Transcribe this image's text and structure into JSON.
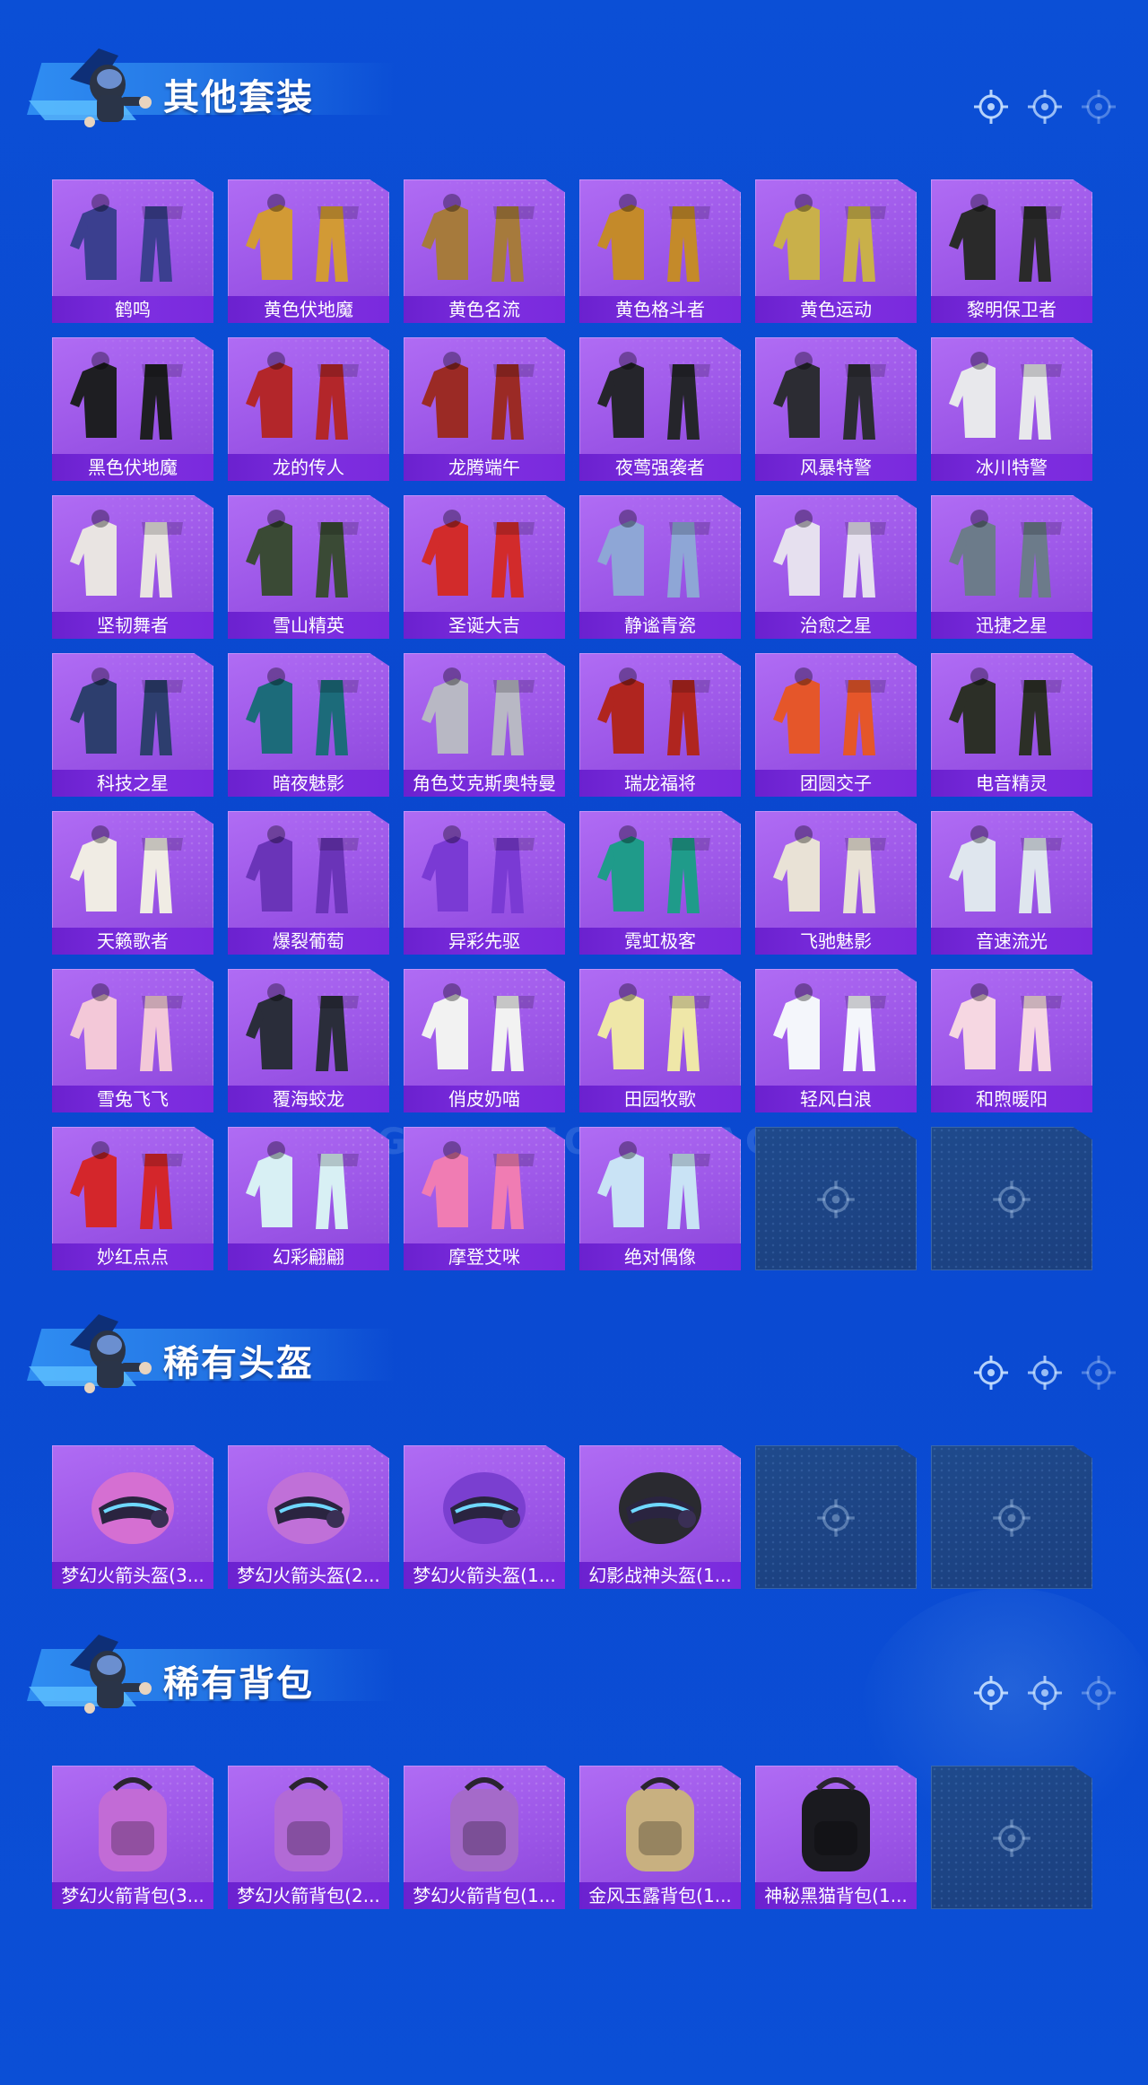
{
  "sections": [
    {
      "title": "其他套装",
      "items": [
        {
          "label": "鹤鸣",
          "icon": "outfit-icon",
          "color": "#3b3f8f"
        },
        {
          "label": "黄色伏地魔",
          "icon": "outfit-icon",
          "color": "#d29a35"
        },
        {
          "label": "黄色名流",
          "icon": "outfit-icon",
          "color": "#a67a3c"
        },
        {
          "label": "黄色格斗者",
          "icon": "outfit-icon",
          "color": "#c48a2a"
        },
        {
          "label": "黄色运动",
          "icon": "outfit-icon",
          "color": "#c9b04a"
        },
        {
          "label": "黎明保卫者",
          "icon": "outfit-icon",
          "color": "#2a2a2a"
        },
        {
          "label": "黑色伏地魔",
          "icon": "outfit-icon",
          "color": "#1e1e22"
        },
        {
          "label": "龙的传人",
          "icon": "outfit-icon",
          "color": "#b3262a"
        },
        {
          "label": "龙腾端午",
          "icon": "outfit-icon",
          "color": "#9b2a25"
        },
        {
          "label": "夜莺强袭者",
          "icon": "outfit-icon",
          "color": "#25252b"
        },
        {
          "label": "风暴特警",
          "icon": "outfit-icon",
          "color": "#2c2c33"
        },
        {
          "label": "冰川特警",
          "icon": "outfit-icon",
          "color": "#e8e8ec"
        },
        {
          "label": "坚韧舞者",
          "icon": "outfit-icon",
          "color": "#e9e4e2"
        },
        {
          "label": "雪山精英",
          "icon": "outfit-icon",
          "color": "#3a4a35"
        },
        {
          "label": "圣诞大吉",
          "icon": "outfit-icon",
          "color": "#d22b2b"
        },
        {
          "label": "静谧青瓷",
          "icon": "outfit-icon",
          "color": "#8ea6d6"
        },
        {
          "label": "治愈之星",
          "icon": "outfit-icon",
          "color": "#e6e0ef"
        },
        {
          "label": "迅捷之星",
          "icon": "outfit-icon",
          "color": "#6c7b8a"
        },
        {
          "label": "科技之星",
          "icon": "outfit-icon",
          "color": "#2d3e6e"
        },
        {
          "label": "暗夜魅影",
          "icon": "outfit-icon",
          "color": "#1c6b7a"
        },
        {
          "label": "角色艾克斯奥特曼",
          "icon": "outfit-icon",
          "color": "#b8b8c4"
        },
        {
          "label": "瑞龙福将",
          "icon": "outfit-icon",
          "color": "#b0251f"
        },
        {
          "label": "团圆交子",
          "icon": "outfit-icon",
          "color": "#e5562a"
        },
        {
          "label": "电音精灵",
          "icon": "outfit-icon",
          "color": "#2c2f27"
        },
        {
          "label": "天籁歌者",
          "icon": "outfit-icon",
          "color": "#f0ece4"
        },
        {
          "label": "爆裂葡萄",
          "icon": "outfit-icon",
          "color": "#6a34b8"
        },
        {
          "label": "异彩先驱",
          "icon": "outfit-icon",
          "color": "#7a3ad4"
        },
        {
          "label": "霓虹极客",
          "icon": "outfit-icon",
          "color": "#1f9b8a"
        },
        {
          "label": "飞驰魅影",
          "icon": "outfit-icon",
          "color": "#e9e2d6"
        },
        {
          "label": "音速流光",
          "icon": "outfit-icon",
          "color": "#dfe6ee"
        },
        {
          "label": "雪兔飞飞",
          "icon": "outfit-icon",
          "color": "#f3c8d8"
        },
        {
          "label": "覆海蛟龙",
          "icon": "outfit-icon",
          "color": "#2a2d3a"
        },
        {
          "label": "俏皮奶喵",
          "icon": "outfit-icon",
          "color": "#f2f2f2"
        },
        {
          "label": "田园牧歌",
          "icon": "outfit-icon",
          "color": "#efe7a8"
        },
        {
          "label": "轻风白浪",
          "icon": "outfit-icon",
          "color": "#f4f6fb"
        },
        {
          "label": "和煦暖阳",
          "icon": "outfit-icon",
          "color": "#f6d7e2"
        },
        {
          "label": "妙红点点",
          "icon": "outfit-icon",
          "color": "#d4262b"
        },
        {
          "label": "幻彩翩翩",
          "icon": "outfit-icon",
          "color": "#d8f0f4"
        },
        {
          "label": "摩登艾咪",
          "icon": "outfit-icon",
          "color": "#f07cb3"
        },
        {
          "label": "绝对偶像",
          "icon": "outfit-icon",
          "color": "#c9e3f5"
        }
      ],
      "empty_slots": 2
    },
    {
      "title": "稀有头盔",
      "items": [
        {
          "label": "梦幻火箭头盔(3...",
          "icon": "helmet-icon",
          "color": "#d56fd2"
        },
        {
          "label": "梦幻火箭头盔(2...",
          "icon": "helmet-icon",
          "color": "#c070d8"
        },
        {
          "label": "梦幻火箭头盔(1...",
          "icon": "helmet-icon",
          "color": "#7a3fd0"
        },
        {
          "label": "幻影战神头盔(1...",
          "icon": "helmet-icon",
          "color": "#2a2a30"
        }
      ],
      "empty_slots": 2
    },
    {
      "title": "稀有背包",
      "items": [
        {
          "label": "梦幻火箭背包(3...",
          "icon": "backpack-icon",
          "color": "#c26bd6"
        },
        {
          "label": "梦幻火箭背包(2...",
          "icon": "backpack-icon",
          "color": "#b26ad6"
        },
        {
          "label": "梦幻火箭背包(1...",
          "icon": "backpack-icon",
          "color": "#a56ac9"
        },
        {
          "label": "金风玉露背包(1...",
          "icon": "backpack-icon",
          "color": "#c8b080"
        },
        {
          "label": "神秘黑猫背包(1...",
          "icon": "backpack-icon",
          "color": "#1a1a1f"
        }
      ],
      "empty_slots": 1
    }
  ],
  "watermark": "GAME FOR PEACE"
}
